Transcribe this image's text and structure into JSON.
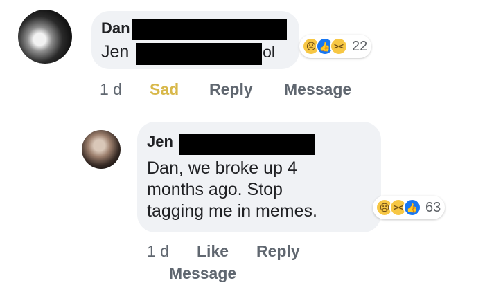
{
  "comment1": {
    "author": "Dan",
    "text_start": "Jen",
    "text_end": "lol",
    "reactions": {
      "icons": [
        "sad-icon",
        "like-icon",
        "haha-icon"
      ],
      "count": "22"
    },
    "time": "1 d",
    "actions": {
      "reaction": "Sad",
      "reply": "Reply",
      "message": "Message"
    }
  },
  "comment2": {
    "author": "Jen",
    "text_lines": [
      "Dan, we broke up 4",
      "months ago. Stop",
      "tagging me in memes."
    ],
    "reactions": {
      "icons": [
        "sad-icon",
        "haha-icon",
        "like-icon"
      ],
      "count": "63"
    },
    "time": "1 d",
    "actions": {
      "like": "Like",
      "reply": "Reply",
      "message": "Message"
    }
  },
  "colors": {
    "bubble": "#f0f2f5",
    "meta_text": "#606770",
    "sad_reaction_label": "#d8b84a",
    "like_blue": "#1877f2",
    "emoji_yellow": "#f7c744"
  }
}
